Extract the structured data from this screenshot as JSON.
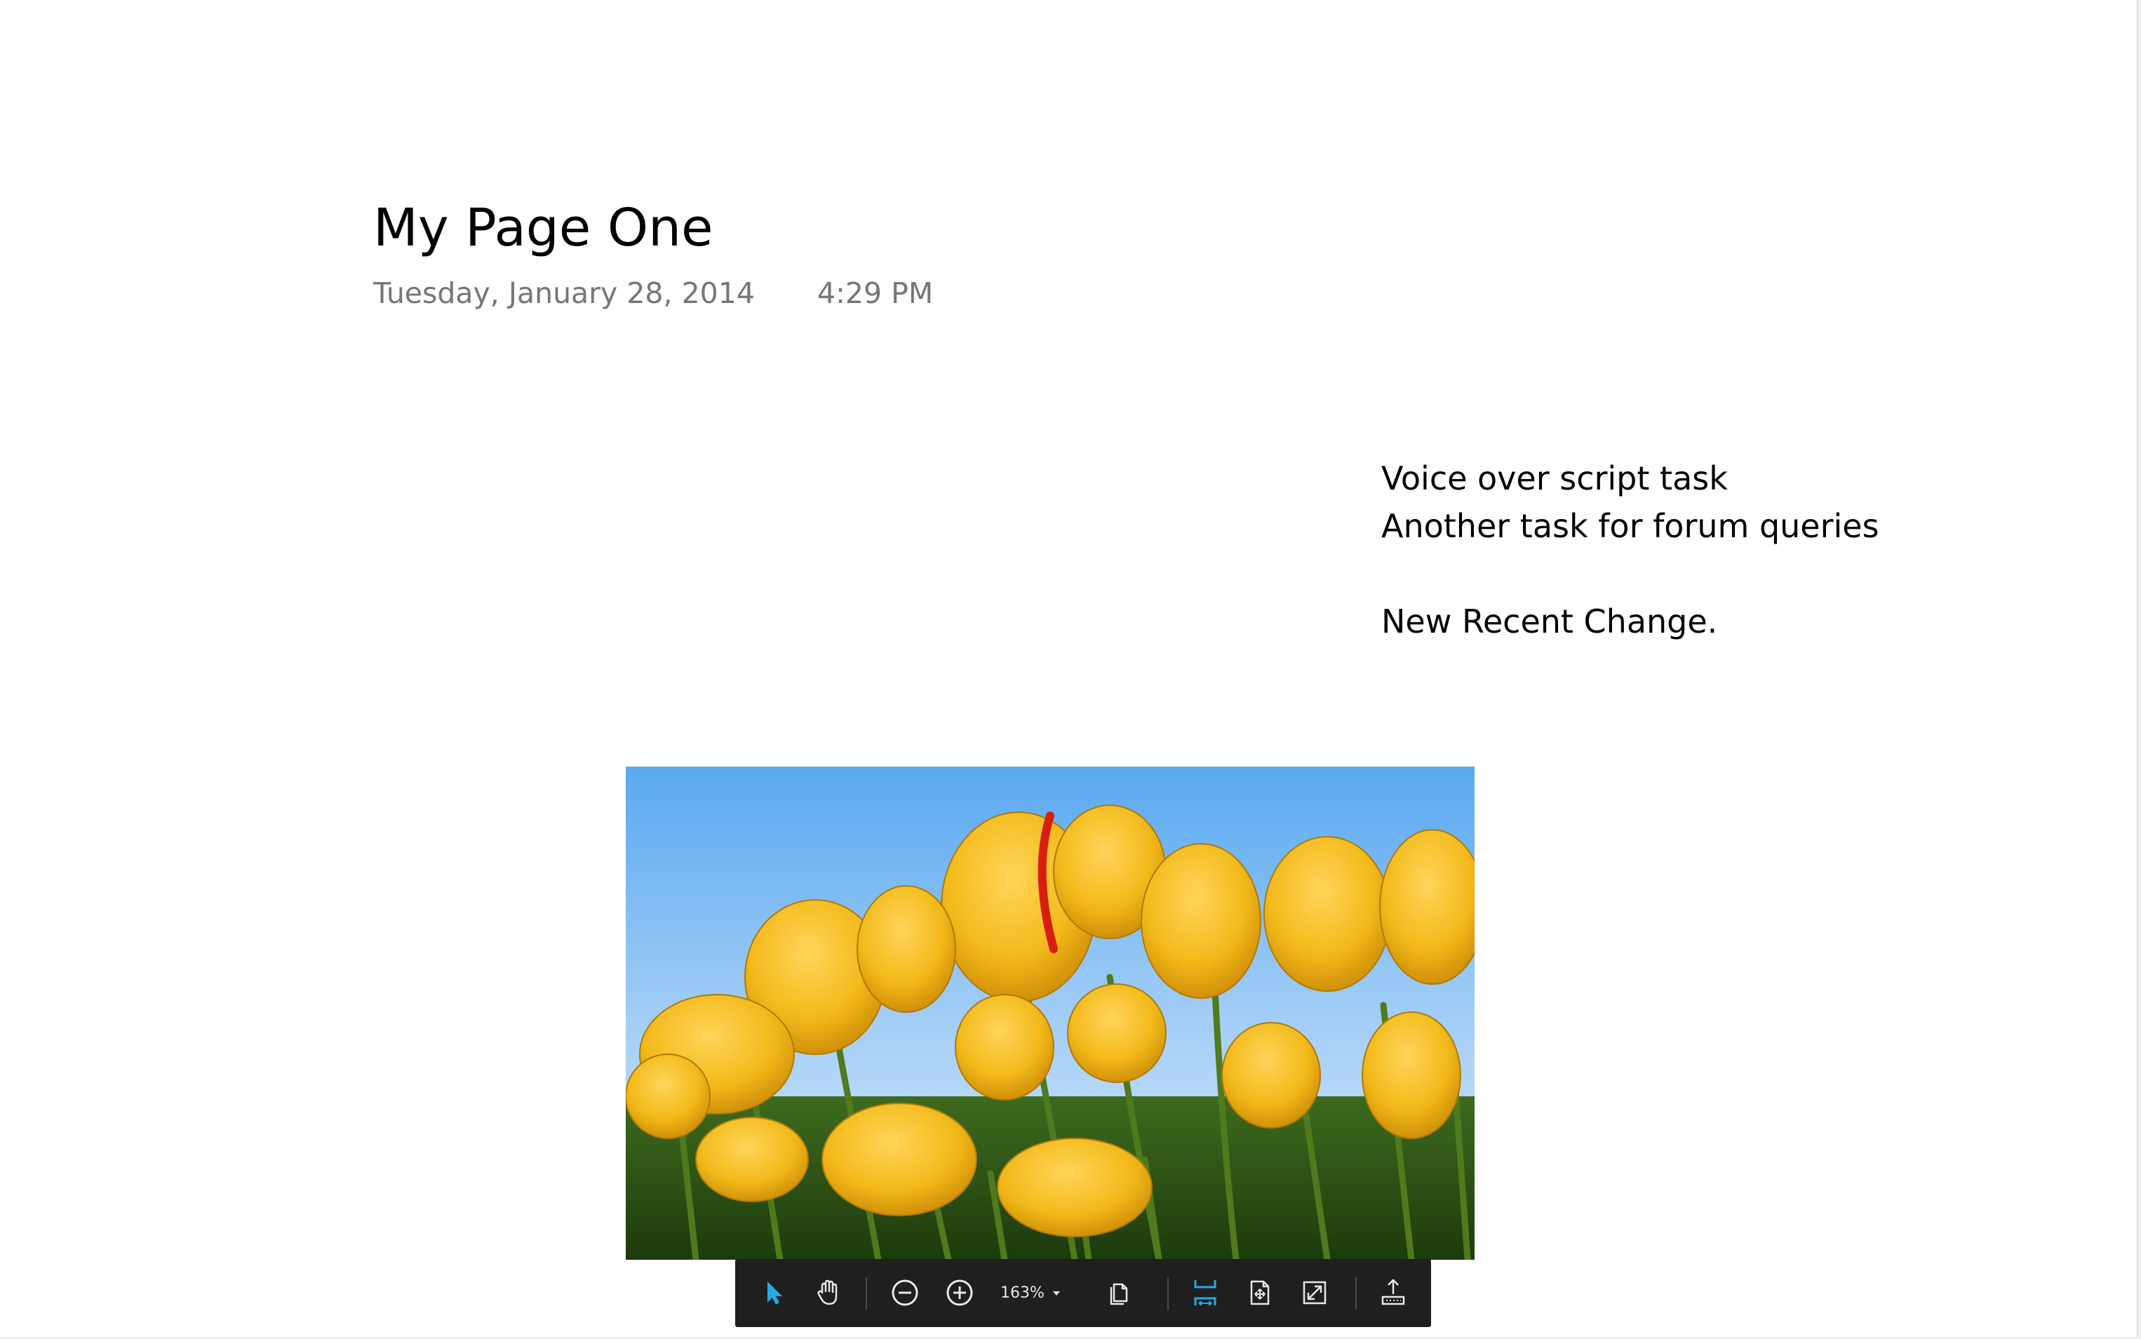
{
  "page": {
    "title": "My Page One",
    "date": "Tuesday, January 28, 2014",
    "time": "4:29 PM"
  },
  "notes": {
    "line1": "Voice over script task",
    "line2": "Another task for forum queries",
    "line3": "New Recent Change."
  },
  "toolbar": {
    "zoom_value": "163%",
    "accent_color": "#29a8e0",
    "icon_color": "#e8e8e8",
    "buttons": [
      {
        "icon": "select-arrow-icon",
        "active": true
      },
      {
        "icon": "hand-pan-icon",
        "active": false
      },
      {
        "icon": "zoom-out-icon",
        "active": false
      },
      {
        "icon": "zoom-in-icon",
        "active": false
      },
      {
        "icon": "zoom-dropdown-icon",
        "active": false
      },
      {
        "icon": "page-view-icon",
        "active": false
      },
      {
        "icon": "fit-width-icon",
        "active": true
      },
      {
        "icon": "fit-page-icon",
        "active": false
      },
      {
        "icon": "fullscreen-icon",
        "active": false
      },
      {
        "icon": "export-icon",
        "active": false
      }
    ]
  },
  "colors": {
    "title": "#000000",
    "meta": "#767676",
    "toolbar_bg": "#1f1f1f",
    "sky_top": "#5aa9f0",
    "sky_bottom": "#bcdcf8",
    "petal": "#f2b91a",
    "petal_stripe": "#d81f0f",
    "stem": "#4f7a1e"
  }
}
